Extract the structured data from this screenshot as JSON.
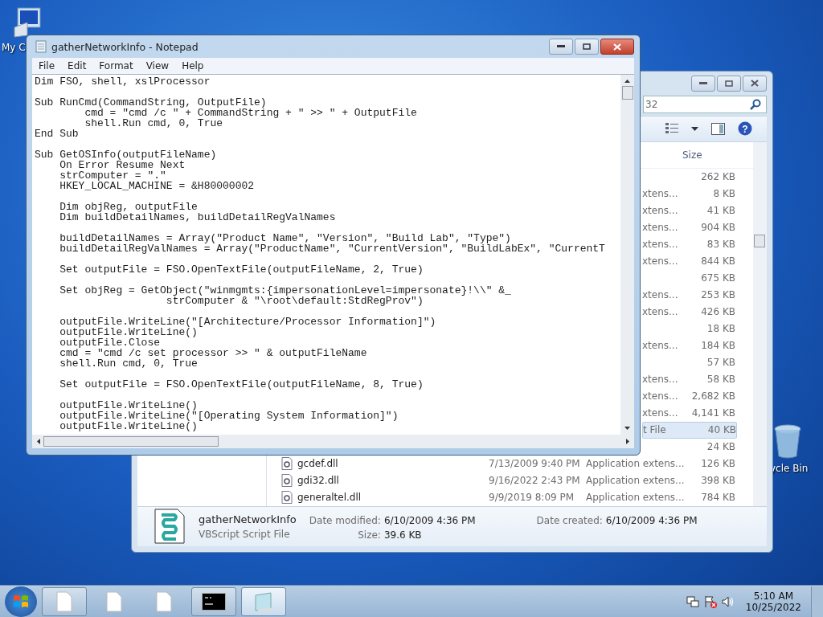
{
  "desktop_icons": [
    {
      "kind": "computer",
      "label": "My C"
    },
    {
      "kind": "recycle-bin",
      "label": "ycle Bin"
    }
  ],
  "explorer": {
    "search": {
      "value": "32"
    },
    "help_glyph": "?",
    "columns": [
      {
        "label": "Size"
      }
    ],
    "rows": [
      {
        "kind": "clipped",
        "size": "262 KB",
        "selected": false
      },
      {
        "kind": "clipped",
        "type": "xtens...",
        "size": "8 KB",
        "selected": false
      },
      {
        "kind": "clipped",
        "type": "xtens...",
        "size": "41 KB",
        "selected": false
      },
      {
        "kind": "clipped",
        "type": "xtens...",
        "size": "904 KB",
        "selected": false
      },
      {
        "kind": "clipped",
        "type": "xtens...",
        "size": "83 KB",
        "selected": false
      },
      {
        "kind": "clipped",
        "type": "xtens...",
        "size": "844 KB",
        "selected": false
      },
      {
        "kind": "clipped",
        "size": "675 KB",
        "selected": false
      },
      {
        "kind": "clipped",
        "type": "xtens...",
        "size": "253 KB",
        "selected": false
      },
      {
        "kind": "clipped",
        "type": "xtens...",
        "size": "426 KB",
        "selected": false
      },
      {
        "kind": "clipped",
        "size": "18 KB",
        "selected": false
      },
      {
        "kind": "clipped",
        "type": "xtens...",
        "size": "184 KB",
        "selected": false
      },
      {
        "kind": "clipped",
        "size": "57 KB",
        "selected": false
      },
      {
        "kind": "clipped",
        "type": "xtens...",
        "size": "58 KB",
        "selected": false
      },
      {
        "kind": "clipped",
        "type": "xtens...",
        "size": "2,682 KB",
        "selected": false
      },
      {
        "kind": "clipped",
        "type": "xtens...",
        "size": "4,141 KB",
        "selected": false
      },
      {
        "kind": "clipped",
        "type": "t File",
        "size": "40 KB",
        "selected": true
      },
      {
        "kind": "clipped",
        "size": "24 KB",
        "selected": false
      },
      {
        "kind": "full",
        "name": "gcdef.dll",
        "date": "7/13/2009 9:40 PM",
        "type": "Application extens...",
        "size": "126 KB",
        "selected": false
      },
      {
        "kind": "full",
        "name": "gdi32.dll",
        "date": "9/16/2022 2:43 PM",
        "type": "Application extens...",
        "size": "398 KB",
        "selected": false
      },
      {
        "kind": "full",
        "name": "generaltel.dll",
        "date": "9/9/2019 8:09 PM",
        "type": "Application extens...",
        "size": "784 KB",
        "selected": false
      }
    ],
    "details": {
      "name": "gatherNetworkInfo",
      "type": "VBScript Script File",
      "date_modified_label": "Date modified:",
      "date_modified": "6/10/2009 4:36 PM",
      "date_created_label": "Date created:",
      "date_created": "6/10/2009 4:36 PM",
      "size_label": "Size:",
      "size": "39.6 KB"
    }
  },
  "notepad": {
    "title": "gatherNetworkInfo - Notepad",
    "menu": [
      "File",
      "Edit",
      "Format",
      "View",
      "Help"
    ],
    "blocks": [
      [
        "Dim FSO, shell, xslProcessor"
      ],
      [
        "Sub RunCmd(CommandString, OutputFile)",
        "        cmd = \"cmd /c \" + CommandString + \" >> \" + OutputFile",
        "        shell.Run cmd, 0, True",
        "End Sub"
      ],
      [
        "Sub GetOSInfo(outputFileName)",
        "    On Error Resume Next",
        "    strComputer = \".\"",
        "    HKEY_LOCAL_MACHINE = &H80000002"
      ],
      [
        "    Dim objReg, outputFile",
        "    Dim buildDetailNames, buildDetailRegValNames"
      ],
      [
        "    buildDetailNames = Array(\"Product Name\", \"Version\", \"Build Lab\", \"Type\")",
        "    buildDetailRegValNames = Array(\"ProductName\", \"CurrentVersion\", \"BuildLabEx\", \"CurrentT"
      ],
      [
        "    Set outputFile = FSO.OpenTextFile(outputFileName, 2, True)"
      ],
      [
        "    Set objReg = GetObject(\"winmgmts:{impersonationLevel=impersonate}!\\\\\" &_",
        "                     strComputer & \"\\root\\default:StdRegProv\")"
      ],
      [
        "    outputFile.WriteLine(\"[Architecture/Processor Information]\")",
        "    outputFile.WriteLine()",
        "    outputFile.Close",
        "    cmd = \"cmd /c set processor >> \" & outputFileName",
        "    shell.Run cmd, 0, True"
      ],
      [
        "    Set outputFile = FSO.OpenTextFile(outputFileName, 8, True)"
      ],
      [
        "    outputFile.WriteLine()",
        "    outputFile.WriteLine(\"[Operating System Information]\")",
        "    outputFile.WriteLine()"
      ]
    ]
  },
  "taskbar": {
    "items": [
      {
        "kind": "document",
        "open": true,
        "selected": false
      },
      {
        "kind": "document",
        "open": false,
        "selected": false
      },
      {
        "kind": "document",
        "open": false,
        "selected": false
      },
      {
        "kind": "console",
        "open": true,
        "selected": false
      },
      {
        "kind": "notepad",
        "open": true,
        "selected": true
      }
    ],
    "clock": {
      "time": "5:10 AM",
      "date": "10/25/2022"
    }
  }
}
